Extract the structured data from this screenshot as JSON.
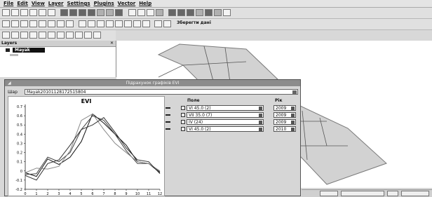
{
  "menu": [
    "File",
    "Edit",
    "View",
    "Layer",
    "Settings",
    "Plugins",
    "Vector",
    "Help"
  ],
  "toolbar": {
    "save_label": "Зберегти дані"
  },
  "layers_panel": {
    "title": "Layers",
    "close": "✕",
    "layer_name": "Mayak"
  },
  "dialog": {
    "title": "Підрахунок графіків EVI",
    "layer_label": "Шар",
    "layer_value": "Mayak20101128172515804"
  },
  "columns": {
    "field": "Поле",
    "year": "Рік"
  },
  "series_rows": [
    {
      "field": "VI 45.0 (2)",
      "year": "2009"
    },
    {
      "field": "VII 35.0 (7)",
      "year": "2009"
    },
    {
      "field": "IV (24)",
      "year": "2009"
    },
    {
      "field": "VI 45.0 (2)",
      "year": "2010"
    }
  ],
  "chart_data": {
    "type": "line",
    "title": "EVI",
    "x": [
      0,
      1,
      2,
      3,
      4,
      5,
      6,
      7,
      8,
      9,
      10,
      11,
      12
    ],
    "x_ticks": [
      "0",
      "1",
      "2",
      "3",
      "4",
      "5",
      "6",
      "7",
      "8",
      "9",
      "10",
      "11",
      "12"
    ],
    "y_ticks": [
      "0.7",
      "0.6",
      "0.5",
      "0.4",
      "0.3",
      "0.2",
      "0.1",
      "0",
      "-0.1",
      "-0.2"
    ],
    "ylim": [
      -0.2,
      0.7
    ],
    "xlim": [
      0,
      12
    ],
    "series": [
      {
        "color": "#111111",
        "values": [
          -0.02,
          -0.06,
          0.13,
          0.07,
          0.15,
          0.32,
          0.62,
          0.52,
          0.4,
          0.28,
          0.1,
          0.08,
          -0.02
        ]
      },
      {
        "color": "#444444",
        "values": [
          -0.04,
          -0.03,
          0.15,
          0.1,
          0.2,
          0.45,
          0.6,
          0.55,
          0.4,
          0.22,
          0.08,
          0.08,
          -0.01
        ]
      },
      {
        "color": "#888888",
        "values": [
          -0.02,
          0.03,
          0.02,
          0.05,
          0.22,
          0.55,
          0.62,
          0.45,
          0.3,
          0.2,
          0.1,
          0.08,
          0.0
        ]
      },
      {
        "color": "#333333",
        "values": [
          -0.05,
          -0.1,
          0.08,
          0.12,
          0.28,
          0.45,
          0.5,
          0.58,
          0.42,
          0.25,
          0.12,
          0.1,
          -0.03
        ]
      }
    ]
  }
}
